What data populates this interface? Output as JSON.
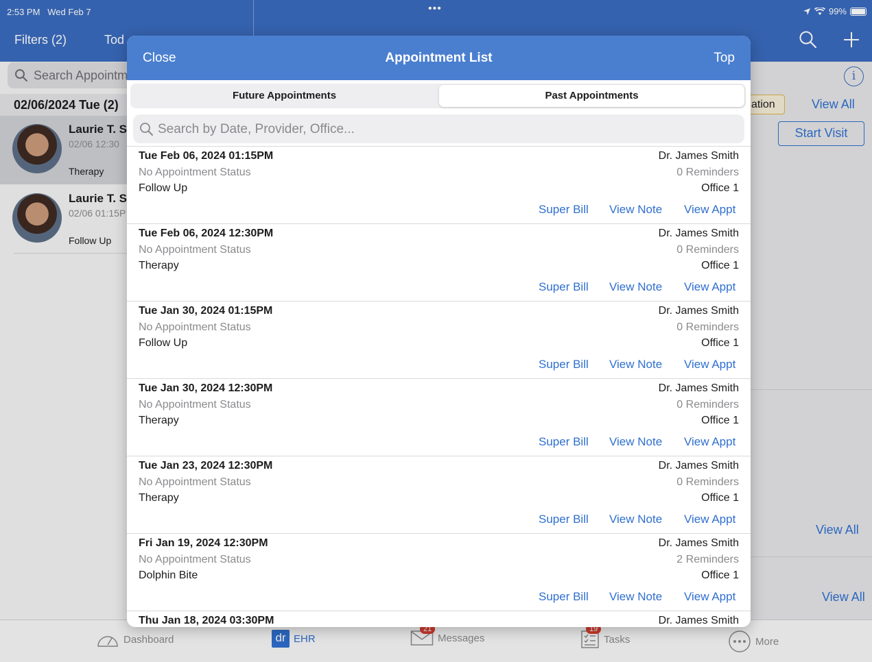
{
  "status_bar": {
    "time": "2:53 PM",
    "date": "Wed Feb 7",
    "battery": "99%"
  },
  "background": {
    "header": {
      "filters": "Filters (2)",
      "today": "Tod"
    },
    "search_placeholder": "Search Appointm",
    "date_heading": "02/06/2024 Tue (2)",
    "patients": [
      {
        "name": "Laurie T. S",
        "time": "02/06 12:30",
        "type": "Therapy"
      },
      {
        "name": "Laurie T. S",
        "time": "02/06 01:15P",
        "type": "Follow Up"
      }
    ],
    "right": {
      "tag": "ation",
      "view_all": "View All",
      "start_visit": "Start Visit",
      "view_all_2": "View All",
      "view_all_3": "View All"
    }
  },
  "modal": {
    "close": "Close",
    "title": "Appointment List",
    "top": "Top",
    "segments": [
      "Future Appointments",
      "Past Appointments"
    ],
    "selected_segment": "Past Appointments",
    "search_placeholder": "Search by Date, Provider, Office...",
    "link_labels": {
      "super_bill": "Super Bill",
      "view_note": "View Note",
      "view_appt": "View Appt"
    },
    "appointments": [
      {
        "datetime": "Tue Feb 06, 2024 01:15PM",
        "status": "No Appointment Status",
        "type": "Follow Up",
        "provider": "Dr. James Smith",
        "reminders": "0 Reminders",
        "office": "Office 1"
      },
      {
        "datetime": "Tue Feb 06, 2024 12:30PM",
        "status": "No Appointment Status",
        "type": "Therapy",
        "provider": "Dr. James Smith",
        "reminders": "0 Reminders",
        "office": "Office 1"
      },
      {
        "datetime": "Tue Jan 30, 2024 01:15PM",
        "status": "No Appointment Status",
        "type": "Follow Up",
        "provider": "Dr. James Smith",
        "reminders": "0 Reminders",
        "office": "Office 1"
      },
      {
        "datetime": "Tue Jan 30, 2024 12:30PM",
        "status": "No Appointment Status",
        "type": "Therapy",
        "provider": "Dr. James Smith",
        "reminders": "0 Reminders",
        "office": "Office 1"
      },
      {
        "datetime": "Tue Jan 23, 2024 12:30PM",
        "status": "No Appointment Status",
        "type": "Therapy",
        "provider": "Dr. James Smith",
        "reminders": "0 Reminders",
        "office": "Office 1"
      },
      {
        "datetime": "Fri Jan 19, 2024 12:30PM",
        "status": "No Appointment Status",
        "type": "Dolphin Bite",
        "provider": "Dr. James Smith",
        "reminders": "2 Reminders",
        "office": "Office 1"
      },
      {
        "datetime": "Thu Jan 18, 2024 03:30PM",
        "status": "",
        "type": "",
        "provider": "Dr. James Smith",
        "reminders": "",
        "office": ""
      }
    ]
  },
  "tabbar": {
    "tabs": [
      {
        "label": "Dashboard",
        "icon": "speedometer-icon"
      },
      {
        "label": "EHR",
        "icon": "dr-logo-icon",
        "logo_text": "dr"
      },
      {
        "label": "Messages",
        "icon": "envelope-icon",
        "badge": "21"
      },
      {
        "label": "Tasks",
        "icon": "checklist-icon",
        "badge": "19"
      },
      {
        "label": "More",
        "icon": "ellipsis-circle-icon"
      }
    ],
    "active": "EHR"
  },
  "colors": {
    "header_blue": "#3a6bbd",
    "modal_header_blue": "#4a7fd0",
    "link_blue": "#2f6fcf",
    "badge_red": "#d63c2f"
  }
}
